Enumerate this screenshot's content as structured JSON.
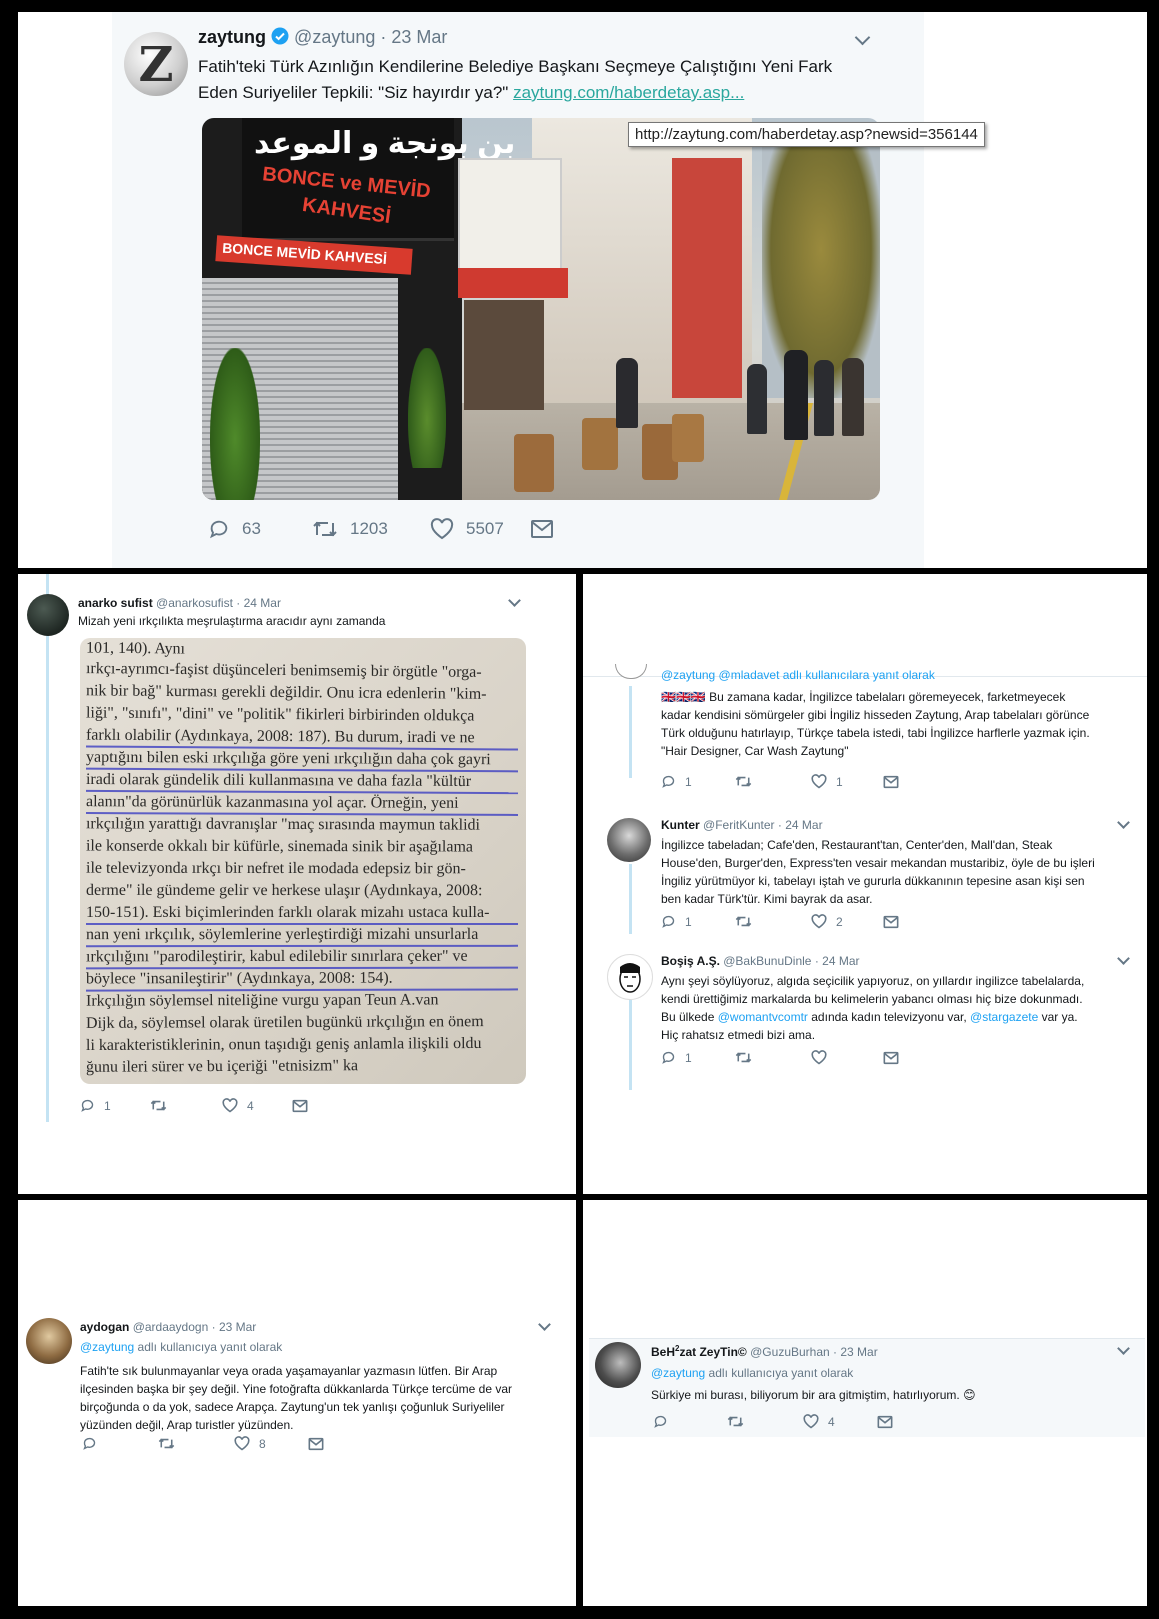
{
  "main_tweet": {
    "name": "zaytung",
    "handle": "@zaytung",
    "date": "23 Mar",
    "avatar_letter": "Z",
    "text_line1": "Fatih'teki Türk Azınlığın Kendilerine Belediye Başkanı Seçmeye Çalıştığını Yeni Fark",
    "text_line2": "Eden Suriyeliler Tepkili: \"Siz hayırdır ya?\"",
    "link": "zaytung.com/haberdetay.asp...",
    "tooltip": "http://zaytung.com/haberdetay.asp?newsid=356144",
    "photo_signs": {
      "arabic_top": "بن بونجة و الموعد",
      "bonce": "BONCE ve MEVİD",
      "kahvesi": "KAHVESİ",
      "awning": "BONCE MEVİD KAHVESİ"
    },
    "replies": "63",
    "retweets": "1203",
    "likes": "5507",
    "verified_color": "#1da1f2"
  },
  "anarko": {
    "name": "anarko sufist",
    "handle": "@anarkosufist",
    "date": "24 Mar",
    "text": "Mizah yeni ırkçılıkta meşrulaştırma aracıdır aynı zamanda",
    "book_lines": [
      "101, 140). Aynı",
      "ırkçı-ayrımcı-faşist düşünceleri benimsemiş bir örgütle \"orga-",
      "nik bir bağ\" kurması gerekli değildir. Onu icra edenlerin \"kim-",
      "liği\", \"sınıfı\", \"dini\" ve \"politik\" fikirleri birbirinden oldukça",
      "farklı olabilir (Aydınkaya, 2008: 187). Bu durum, iradi ve ne",
      "yaptığını bilen eski ırkçılığa göre yeni ırkçılığın daha çok gayri",
      "iradi olarak gündelik dili kullanmasına ve daha fazla \"kültür",
      "alanın\"da görünürlük kazanmasına yol açar. Örneğin, yeni",
      "ırkçılığın yarattığı davranışlar \"maç sırasında maymun taklidi",
      "ile konserde okkalı bir küfürle, sinemada sinik bir aşağılama",
      "ile televizyonda ırkçı bir nefret ile modada edepsiz bir gön-",
      "derme\" ile gündeme gelir ve herkese ulaşır (Aydınkaya, 2008:",
      "150-151). Eski biçimlerinden farklı olarak mizahı ustaca kulla-",
      "nan yeni ırkçılık, söylemlerine yerleştirdiği mizahi unsurlarla",
      "ırkçılığını \"parodileştirir, kabul edilebilir sınırlara çeker\" ve",
      "böylece \"insanileştirir\" (Aydınkaya, 2008: 154).",
      "Irkçılığın söylemsel niteliğine vurgu yapan Teun A.van",
      "Dijk da, söylemsel olarak üretilen bugünkü ırkçılığın en önem",
      "li karakteristiklerinin, onun taşıdığı geniş anlamla ilişkili oldu",
      "ğunu ileri sürer ve bu içeriği \"etnisizm\" ka"
    ],
    "replies": "1",
    "likes": "4"
  },
  "thread": {
    "top_reply_to": "@zaytung @mladavet adlı kullanıcılara yanıt olarak",
    "flags": "🇬🇧🇬🇧🇬🇧",
    "top_text": [
      "Bu zamana kadar, İngilizce tabelaları göremeyecek, farketmeyecek",
      "kadar kendisini sömürgeler gibi İngiliz hisseden Zaytung, Arap tabelaları görünce",
      "Türk olduğunu hatırlayıp, Türkçe tabela istedi, tabi İngilizce harflerle yazmak için.",
      "\"Hair Designer, Car Wash Zaytung\""
    ],
    "top_replies": "1",
    "top_likes": "1",
    "kunter": {
      "name": "Kunter",
      "handle": "@FeritKunter",
      "date": "24 Mar",
      "text": [
        "İngilizce tabeladan; Cafe'den, Restaurant'tan, Center'den, Mall'dan, Steak",
        "House'den, Burger'den, Express'ten vesair mekandan mustaribiz, öyle de bu işleri",
        "İngiliz yürütmüyor ki, tabelayı iştah ve gururla dükkanının tepesine asan kişi sen",
        "ben kadar Türk'tür. Kimi bayrak da asar."
      ],
      "replies": "1",
      "likes": "2"
    },
    "bosis": {
      "name": "Boşiş A.Ş.",
      "handle": "@BakBunuDinle",
      "date": "24 Mar",
      "text1": "Aynı şeyi söylüyoruz, algıda seçicilik yapıyoruz, on yıllardır ingilizce tabelalarda,",
      "text2": "kendi ürettiğimiz markalarda bu kelimelerin yabancı olması hiç bize dokunmadı.",
      "text3_pre": "Bu ülkede ",
      "mention1": "@womantvcomtr",
      "text3_mid": " adında kadın televizyonu var, ",
      "mention2": "@stargazete",
      "text3_post": " var ya.",
      "text4": "Hiç rahatsız etmedi bizi ama.",
      "replies": "1"
    }
  },
  "aydogan": {
    "name": "aydogan",
    "handle": "@ardaaydogn",
    "date": "23 Mar",
    "mention": "@zaytung",
    "reply_suffix": " adlı kullanıcıya yanıt olarak",
    "text": [
      "Fatih'te sık bulunmayanlar veya orada yaşamayanlar yazmasın lütfen.  Bir Arap",
      "ilçesinden başka bir şey değil. Yine fotoğrafta dükkanlarda Türkçe tercüme de var",
      "birçoğunda o da yok, sadece Arapça. Zaytung'un tek yanlışı çoğunluk Suriyeliler",
      "yüzünden değil, Arap turistler yüzünden."
    ],
    "likes": "8"
  },
  "behzat": {
    "name_pre": "BeH",
    "name_sup": "2",
    "name_post": "zat ZeyTin©",
    "handle": "@GuzuBurhan",
    "date": "23 Mar",
    "mention": "@zaytung",
    "reply_suffix": " adlı kullanıcıya yanıt olarak",
    "text": "Sürkiye mi burası, biliyorum bir ara gitmiştim, hatırlıyorum.",
    "emoji": "😊",
    "likes": "4"
  },
  "colors": {
    "link": "#1da1f2",
    "muted": "#657786",
    "thread": "#c4e3f3",
    "pen": "#3c3ec2"
  }
}
